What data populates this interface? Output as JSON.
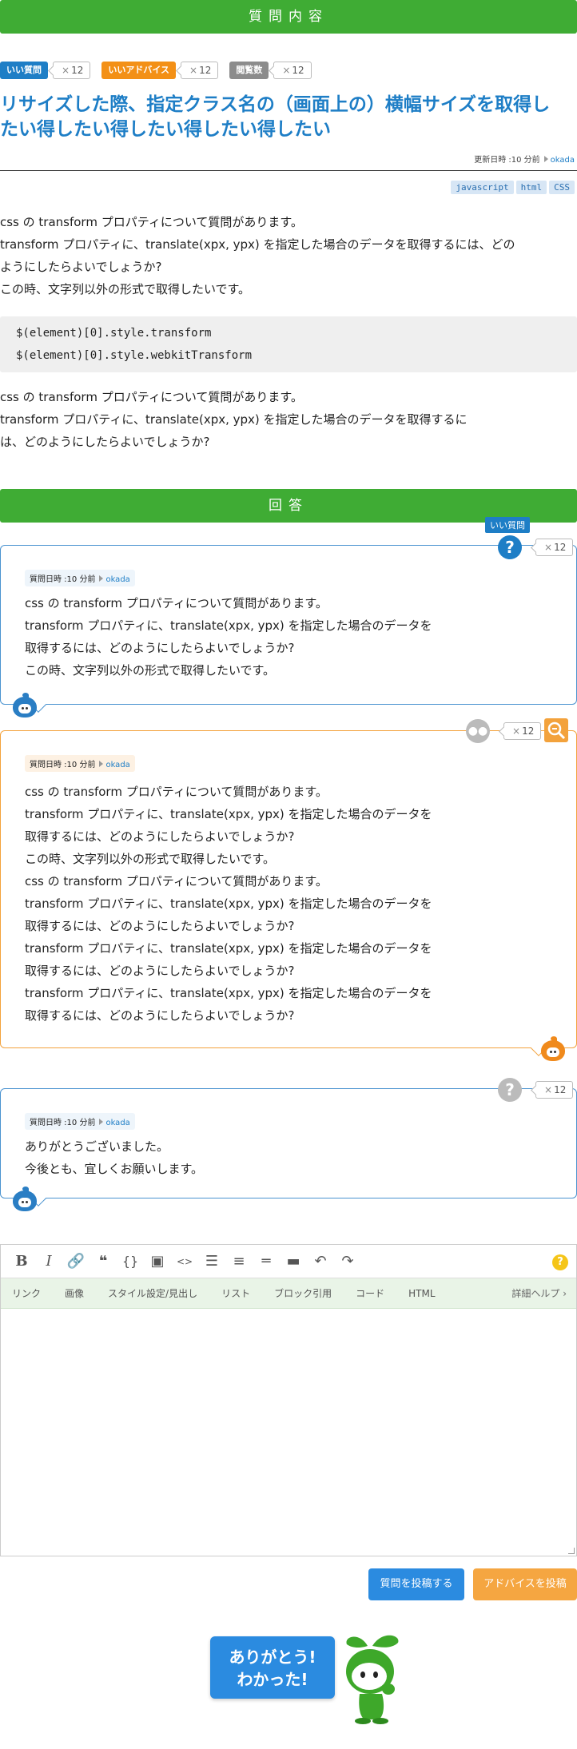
{
  "question_header": "質問内容",
  "answer_header": "回答",
  "badges": [
    {
      "label": "いい質問",
      "count": "12",
      "color": "#1e7ec6"
    },
    {
      "label": "いいアドバイス",
      "count": "12",
      "color": "#f39016"
    },
    {
      "label": "閲覧数",
      "count": "12",
      "color": "#8c8c8c"
    }
  ],
  "count_prefix": "×",
  "title": "リサイズした際、指定クラス名の（画面上の）横幅サイズを取得したい得したい得したい得したい得したい",
  "updated": {
    "label": "更新日時 :10 分前",
    "user": "okada"
  },
  "tags": [
    "javascript",
    "html",
    "CSS"
  ],
  "question_body_1": [
    "css の transform プロパティについて質問があります。",
    "transform プロパティに、translate(xpx, ypx) を指定した場合のデータを取得するには、どの",
    "ようにしたらよいでしょうか?",
    "この時、文字列以外の形式で取得したいです。"
  ],
  "code_lines": [
    "$(element)[0].style.transform",
    "$(element)[0].style.webkitTransform"
  ],
  "question_body_2": [
    "css の transform プロパティについて質問があります。",
    "transform プロパティに、translate(xpx, ypx) を指定した場合のデータを取得するに",
    "は、どのようにしたらよいでしょうか?"
  ],
  "answers": [
    {
      "meta": "質問日時 :10 分前",
      "user": "okada",
      "count": "12",
      "badge_label": "いい質問",
      "lines": [
        "css の transform プロパティについて質問があります。",
        "transform プロパティに、translate(xpx, ypx) を指定した場合のデータを",
        "取得するには、どのようにしたらよいでしょうか?",
        "この時、文字列以外の形式で取得したいです。"
      ]
    },
    {
      "meta": "質問日時 :10 分前",
      "user": "okada",
      "count": "12",
      "lines": [
        "css の transform プロパティについて質問があります。",
        "transform プロパティに、translate(xpx, ypx) を指定した場合のデータを",
        "取得するには、どのようにしたらよいでしょうか?",
        "この時、文字列以外の形式で取得したいです。",
        "css の transform プロパティについて質問があります。",
        "transform プロパティに、translate(xpx, ypx) を指定した場合のデータを",
        "取得するには、どのようにしたらよいでしょうか?",
        "transform プロパティに、translate(xpx, ypx) を指定した場合のデータを",
        "取得するには、どのようにしたらよいでしょうか?",
        "transform プロパティに、translate(xpx, ypx) を指定した場合のデータを",
        "取得するには、どのようにしたらよいでしょうか?"
      ]
    },
    {
      "meta": "質問日時 :10 分前",
      "user": "okada",
      "count": "12",
      "lines": [
        "ありがとうございました。",
        "今後とも、宜しくお願いします。"
      ]
    }
  ],
  "editor": {
    "tabs": [
      "リンク",
      "画像",
      "スタイル設定/見出し",
      "リスト",
      "ブロック引用",
      "コード",
      "HTML"
    ],
    "detail_help": "詳細ヘルプ",
    "help_icon": "?"
  },
  "buttons": {
    "post_question": "質問を投稿する",
    "post_advice": "アドバイスを投稿"
  },
  "thanks": {
    "line1": "ありがとう!",
    "line2": "わかった!"
  },
  "colors": {
    "green": "#3fac34",
    "blue": "#1e7ec6",
    "orange": "#f39016"
  }
}
